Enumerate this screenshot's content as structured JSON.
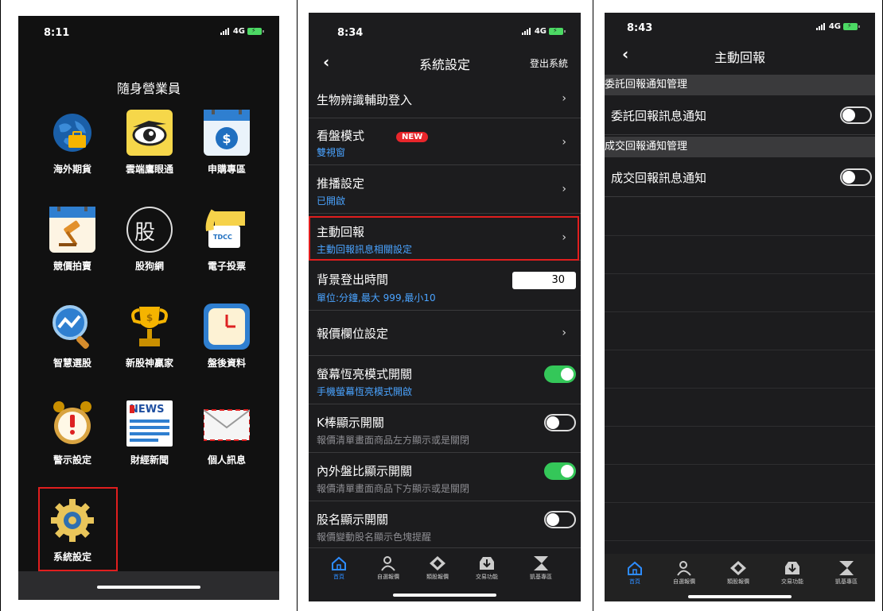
{
  "status": {
    "p1_time": "8:11",
    "p2_time": "8:34",
    "p3_time": "8:43",
    "network": "4G"
  },
  "p1": {
    "title": "隨身營業員",
    "apps": [
      {
        "label": "海外期貨",
        "icon": "globe-briefcase-icon"
      },
      {
        "label": "雲端鷹眼通",
        "icon": "eagle-eye-icon"
      },
      {
        "label": "申購專區",
        "icon": "calendar-dollar-icon"
      },
      {
        "label": "競價拍賣",
        "icon": "calendar-gavel-icon"
      },
      {
        "label": "股狗網",
        "icon": "stock-dog-icon"
      },
      {
        "label": "電子投票",
        "icon": "tdcc-card-icon"
      },
      {
        "label": "智慧選股",
        "icon": "magnifier-chart-icon"
      },
      {
        "label": "新股神贏家",
        "icon": "trophy-icon"
      },
      {
        "label": "盤後資料",
        "icon": "clock-icon"
      },
      {
        "label": "警示設定",
        "icon": "alarm-clock-icon"
      },
      {
        "label": "財經新聞",
        "icon": "news-icon"
      },
      {
        "label": "個人訊息",
        "icon": "envelope-icon"
      },
      {
        "label": "系統設定",
        "icon": "gear-icon"
      }
    ],
    "stock_char": "股",
    "news_text": "NEWS",
    "tdcc_text": "TDCC"
  },
  "p2": {
    "back": "‹",
    "title": "系統設定",
    "logout": "登出系統",
    "new_badge": "NEW",
    "rows": {
      "bio": {
        "title": "生物辨識輔助登入"
      },
      "view": {
        "title": "看盤模式",
        "sub": "雙視窗"
      },
      "push": {
        "title": "推播設定",
        "sub": "已開啟"
      },
      "report": {
        "title": "主動回報",
        "sub": "主動回報訊息相關設定"
      },
      "logout_time": {
        "title": "背景登出時間",
        "sub": "單位:分鐘,最大 999,最小10",
        "value": "30"
      },
      "quote": {
        "title": "報價欄位設定"
      },
      "screen": {
        "title": "螢幕恆亮模式開關",
        "sub": "手機螢幕恆亮模式開啟",
        "on": true
      },
      "kbar": {
        "title": "K棒顯示開關",
        "sub": "報價清單畫面商品左方顯示或是關閉",
        "on": false
      },
      "ratio": {
        "title": "內外盤比顯示開關",
        "sub": "報價清單畫面商品下方顯示或是關閉",
        "on": true
      },
      "name": {
        "title": "股名顯示開關",
        "sub": "報價變動股名顯示色塊提醒",
        "on": false
      }
    },
    "chevron": "›"
  },
  "p3": {
    "back": "‹",
    "title": "主動回報",
    "sec1": "委託回報通知管理",
    "row1": "委託回報訊息通知",
    "sec2": "成交回報通知管理",
    "row2": "成交回報訊息通知"
  },
  "tabs": [
    "首頁",
    "自選報價",
    "類股報價",
    "交易功能",
    "凱基專區"
  ],
  "colors": {
    "accent_blue": "#4aa3ff",
    "toggle_on": "#34c759",
    "highlight_red": "#e01e1e",
    "badge_red": "#e8262b"
  }
}
